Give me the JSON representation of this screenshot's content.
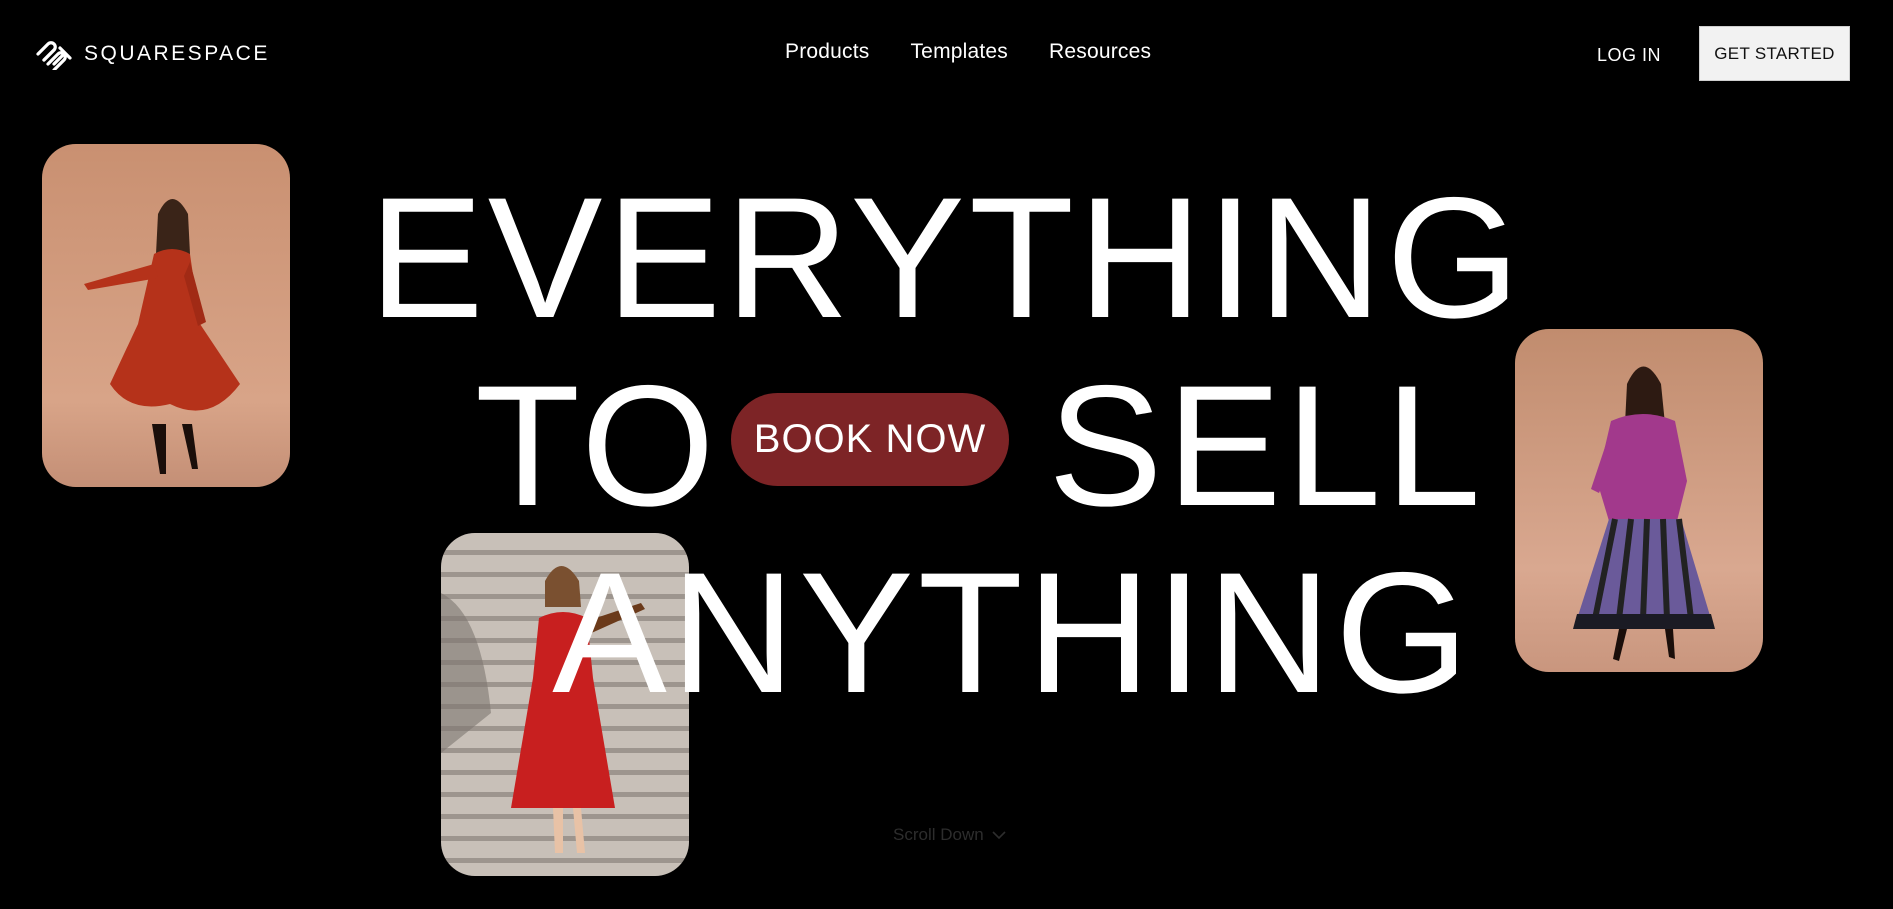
{
  "header": {
    "brand": "SQUARESPACE",
    "nav": [
      {
        "label": "Products"
      },
      {
        "label": "Templates"
      },
      {
        "label": "Resources"
      }
    ],
    "login_label": "LOG IN",
    "cta_label": "GET STARTED"
  },
  "hero": {
    "line1": "EVERYTHING",
    "line2_left": "TO",
    "line2_right": "SELL",
    "line3": "ANYTHING",
    "book_label": "BOOK NOW",
    "scroll_label": "Scroll Down"
  },
  "colors": {
    "background": "#000000",
    "text": "#ffffff",
    "book_button": "#7d2426",
    "cta_bg": "#f2f2f2"
  },
  "icons": [
    "squarespace-logo-icon",
    "chevron-down-icon"
  ]
}
